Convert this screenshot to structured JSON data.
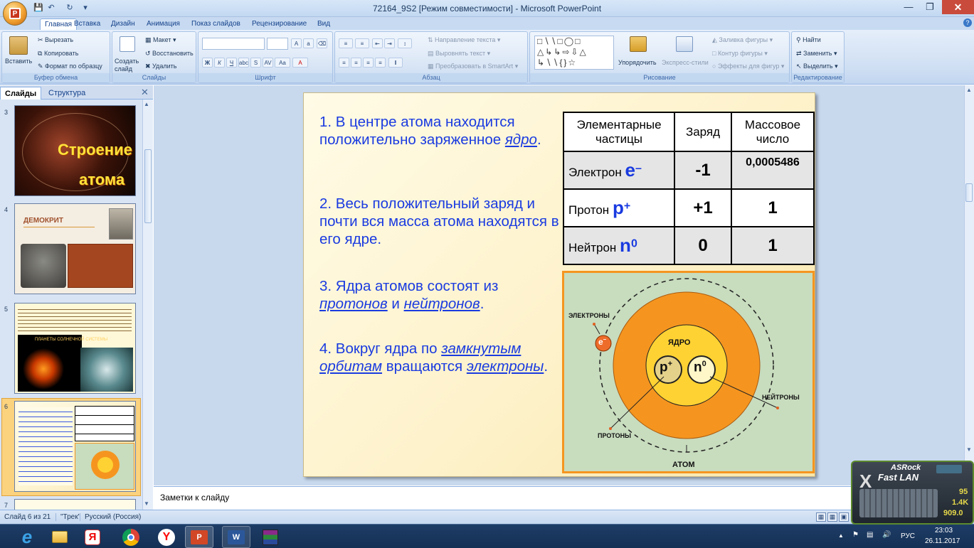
{
  "window": {
    "title": "72164_9S2 [Режим совместимости] - Microsoft PowerPoint"
  },
  "ribbon_tabs": [
    "Главная",
    "Вставка",
    "Дизайн",
    "Анимация",
    "Показ слайдов",
    "Рецензирование",
    "Вид"
  ],
  "ribbon": {
    "clipboard": {
      "group": "Буфер обмена",
      "paste": "Вставить",
      "cut": "Вырезать",
      "copy": "Копировать",
      "format": "Формат по образцу"
    },
    "slides": {
      "group": "Слайды",
      "create": "Создать слайд",
      "layout": "Макет",
      "reset": "Восстановить",
      "delete": "Удалить"
    },
    "font": {
      "group": "Шрифт"
    },
    "paragraph": {
      "group": "Абзац",
      "direction": "Направление текста",
      "align": "Выровнять текст",
      "smartart": "Преобразовать в SmartArt"
    },
    "drawing": {
      "group": "Рисование",
      "arrange": "Упорядочить",
      "quick_styles": "Экспресс-стили",
      "fill": "Заливка фигуры",
      "outline": "Контур фигуры",
      "effects": "Эффекты для фигур"
    },
    "editing": {
      "group": "Редактирование",
      "find": "Найти",
      "replace": "Заменить",
      "select": "Выделить"
    }
  },
  "left_pane": {
    "tabs": [
      "Слайды",
      "Структура"
    ],
    "thumbs": [
      {
        "num": "3",
        "title_top": "Строение",
        "title_bottom": "атома"
      },
      {
        "num": "4",
        "title": "ДЕМОКРИТ"
      },
      {
        "num": "5",
        "caption": "ПЛАНЕТЫ СОЛНЕЧНОЙ СИСТЕМЫ"
      },
      {
        "num": "6"
      },
      {
        "num": "7"
      }
    ]
  },
  "slide": {
    "points": [
      {
        "text_before": "1. В центре атома находится положительно заряженное ",
        "link": "ядро",
        "text_after": "."
      },
      {
        "text_before": "2. Весь положительный заряд и почти вся масса атома находятся в его ядре.",
        "link": "",
        "text_after": ""
      },
      {
        "text_before": "3. Ядра атомов состоят из ",
        "link": "протонов",
        "mid": " и ",
        "link2": "нейтронов",
        "text_after": "."
      },
      {
        "text_before": "4. Вокруг ядра по ",
        "link": "замкнутым орбитам",
        "mid": " вращаются ",
        "link2": "электроны",
        "text_after": "."
      }
    ],
    "table": {
      "headers": [
        "Элементарные частицы",
        "Заряд",
        "Массовое число"
      ],
      "rows": [
        {
          "name": "Электрон",
          "symbol": "e",
          "sup": "–",
          "charge": "-1",
          "mass": "0,0005486"
        },
        {
          "name": "Протон",
          "symbol": "p",
          "sup": "+",
          "charge": "+1",
          "mass": "1"
        },
        {
          "name": "Нейтрон",
          "symbol": "n",
          "sup": "0",
          "charge": "0",
          "mass": "1"
        }
      ]
    },
    "diagram": {
      "electrons": "ЭЛЕКТРОНЫ",
      "nucleus": "ЯДРО",
      "neutrons": "НЕЙТРОНЫ",
      "protons": "ПРОТОНЫ",
      "atom": "АТОМ",
      "e_symbol": "e",
      "e_sup": "–",
      "p_symbol": "p",
      "p_sup": "+",
      "n_symbol": "n",
      "n_sup": "0"
    }
  },
  "notes_placeholder": "Заметки к слайду",
  "status": {
    "slide_info": "Слайд 6 из 21",
    "theme": "\"Трек\"",
    "language": "Русский (Россия)"
  },
  "taskbar": {
    "lang": "РУС",
    "time": "23:03",
    "date": "26.11.2017"
  },
  "asrock": {
    "brand": "ASRock",
    "product": "Fast LAN",
    "v1": "95",
    "v2": "1.4K",
    "v3": "909.0"
  },
  "colors": {
    "accent_blue": "#1a3be0",
    "orange": "#f5951f",
    "nucleus_yellow": "#ffd233",
    "diagram_bg": "#c8dcbe"
  }
}
